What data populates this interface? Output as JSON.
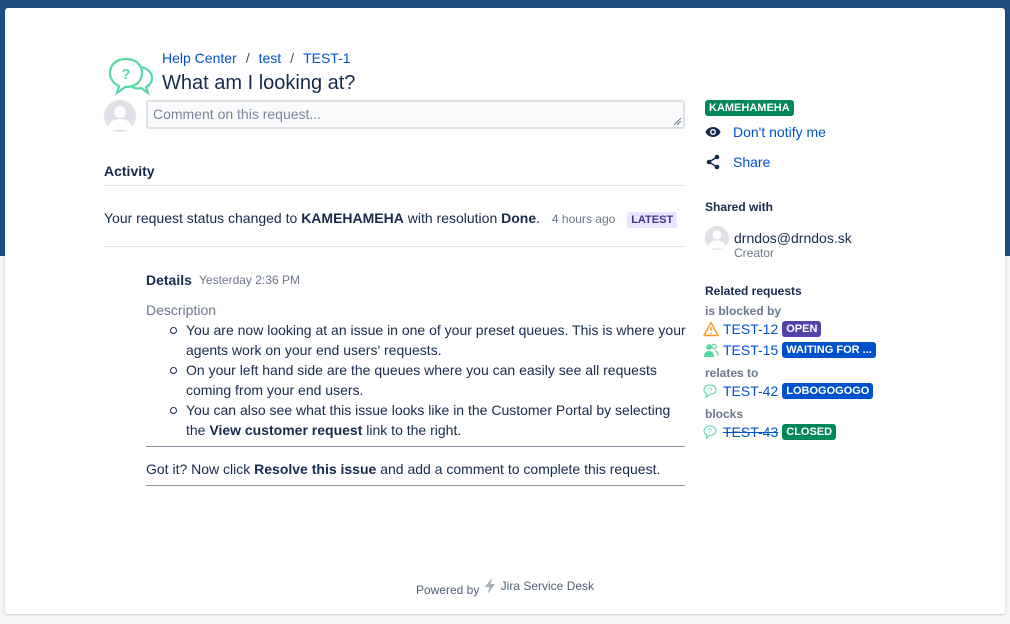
{
  "breadcrumb": [
    "Help Center",
    "test",
    "TEST-1"
  ],
  "request": {
    "title": "What am I looking at?"
  },
  "comment": {
    "placeholder": "Comment on this request..."
  },
  "activity": {
    "title": "Activity",
    "status_prefix": "Your request status changed to ",
    "status_value": "KAMEHAMEHA",
    "status_middle": " with resolution ",
    "resolution": "Done",
    "status_suffix": ".",
    "time": "4 hours ago",
    "latest_badge": "LATEST"
  },
  "details": {
    "label": "Details",
    "time": "Yesterday 2:36 PM",
    "description_label": "Description",
    "items": [
      "You are now looking at an issue in one of your preset queues. This is where your agents work on your end users' requests.",
      "On your left hand side are the queues where you can easily see all requests coming from your end users.",
      {
        "pre": "You can also see what this issue looks like in the Customer Portal by selecting the ",
        "bold": "View customer request",
        "post": " link to the right."
      }
    ],
    "gotit_pre": "Got it? Now click ",
    "gotit_bold": "Resolve this issue",
    "gotit_post": " and add a comment to complete this request."
  },
  "sidebar": {
    "status": "KAMEHAMEHA",
    "notify_label": "Don't notify me",
    "share_label": "Share",
    "shared_with_title": "Shared with",
    "creator_name": "drndos@drndos.sk",
    "creator_role": "Creator",
    "related_title": "Related requests",
    "groups": [
      {
        "label": "is blocked by",
        "items": [
          {
            "key": "TEST-12",
            "status": "OPEN",
            "icon": "warning-icon",
            "color": "purple"
          },
          {
            "key": "TEST-15",
            "status": "WAITING FOR ...",
            "icon": "users-icon",
            "color": "blue"
          }
        ]
      },
      {
        "label": "relates to",
        "items": [
          {
            "key": "TEST-42",
            "status": "LOBOGOGOGO",
            "icon": "help-icon",
            "color": "blue"
          }
        ]
      },
      {
        "label": "blocks",
        "items": [
          {
            "key": "TEST-43",
            "status": "CLOSED",
            "icon": "help-icon",
            "color": "green",
            "done": true
          }
        ]
      }
    ]
  },
  "footer": {
    "powered_by": "Powered by",
    "product": "Jira Service Desk"
  },
  "colors": {
    "header_band": "#1e4d7e",
    "link": "#0052cc",
    "text": "#172b4d",
    "green": "#00875a",
    "blue": "#0052cc",
    "purple": "#5243aa"
  }
}
